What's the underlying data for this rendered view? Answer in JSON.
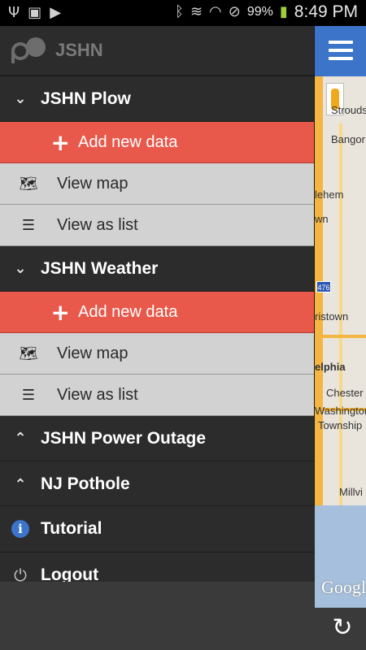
{
  "status_bar": {
    "time": "8:49 PM",
    "battery": "99%",
    "left_icons": [
      "usb-icon",
      "sim-icon",
      "play-store-icon"
    ],
    "right_icons": [
      "bluetooth-icon",
      "mute-icon",
      "wifi-icon",
      "do-not-disturb-icon",
      "battery-charging-icon"
    ]
  },
  "drawer": {
    "app_title": "JSHN",
    "groups": [
      {
        "title": "JSHN Plow",
        "expanded": true,
        "items": [
          {
            "label": "Add new data",
            "icon": "plus-icon"
          },
          {
            "label": "View map",
            "icon": "map-icon"
          },
          {
            "label": "View as list",
            "icon": "list-icon"
          }
        ]
      },
      {
        "title": "JSHN Weather",
        "expanded": true,
        "items": [
          {
            "label": "Add new data",
            "icon": "plus-icon"
          },
          {
            "label": "View map",
            "icon": "map-icon"
          },
          {
            "label": "View as list",
            "icon": "list-icon"
          }
        ]
      },
      {
        "title": "JSHN Power Outage",
        "expanded": false
      },
      {
        "title": "NJ Pothole",
        "expanded": false
      }
    ],
    "footer": [
      {
        "label": "Tutorial",
        "icon": "info-icon"
      },
      {
        "label": "Logout",
        "icon": "power-icon"
      }
    ]
  },
  "map": {
    "labels": [
      "Stroudsb",
      "Bangor",
      "lehem",
      "wn",
      "ristown",
      "elphia",
      "Chester",
      "Washington",
      "Township",
      "Millvi"
    ],
    "highway_shield": "476",
    "attribution": "Google"
  },
  "colors": {
    "accent": "#e9594b",
    "drawer_bg": "#2c2c2c",
    "sub_item_bg": "#d2d2d2",
    "map_header": "#3b74c9"
  }
}
